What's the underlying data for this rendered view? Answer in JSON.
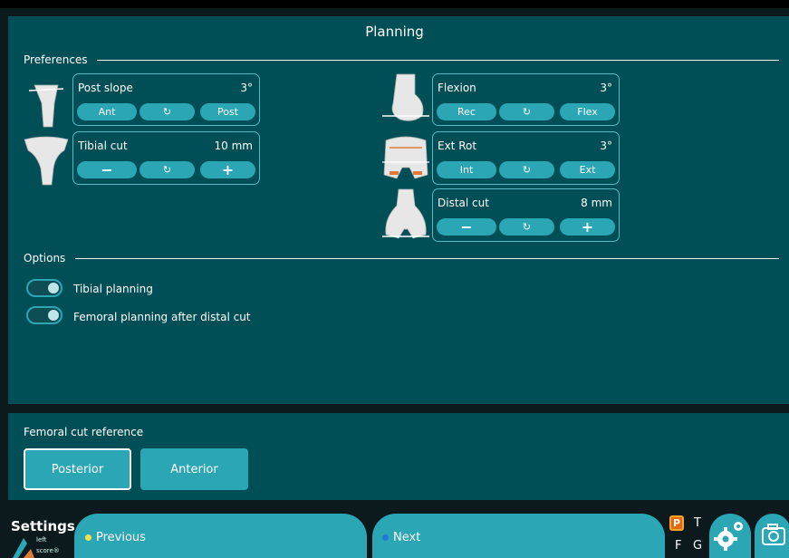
{
  "header": {
    "title": "Planning"
  },
  "preferences": {
    "label": "Preferences",
    "post_slope": {
      "name": "Post slope",
      "value": "3°",
      "btn_left": "Ant",
      "btn_reset": "↻",
      "btn_right": "Post"
    },
    "tibial_cut": {
      "name": "Tibial cut",
      "value": "10 mm",
      "btn_left": "−",
      "btn_reset": "↻",
      "btn_right": "+"
    },
    "flexion": {
      "name": "Flexion",
      "value": "3°",
      "btn_left": "Rec",
      "btn_reset": "↻",
      "btn_right": "Flex"
    },
    "ext_rot": {
      "name": "Ext Rot",
      "value": "3°",
      "btn_left": "Int",
      "btn_reset": "↻",
      "btn_right": "Ext"
    },
    "distal_cut": {
      "name": "Distal cut",
      "value": "8 mm",
      "btn_left": "−",
      "btn_reset": "↻",
      "btn_right": "+"
    }
  },
  "options": {
    "label": "Options",
    "tibial_planning": {
      "label": "Tibial planning",
      "enabled": true
    },
    "femoral_planning": {
      "label": "Femoral planning after distal cut",
      "enabled": true
    }
  },
  "femoral_cut_reference": {
    "label": "Femoral cut reference",
    "options": [
      "Posterior",
      "Anterior"
    ],
    "selected": "Posterior"
  },
  "footer": {
    "title": "Settings",
    "logo_line1": "left",
    "logo_line2": "score®",
    "previous_label": "Previous",
    "next_label": "Next",
    "indicators": {
      "p": "P",
      "t": "T",
      "f": "F",
      "g": "G"
    }
  },
  "icons": [
    "tibia-slope-icon",
    "tibia-cut-icon",
    "femur-flexion-icon",
    "femur-rotation-icon",
    "femur-distal-icon",
    "gear-icon",
    "camera-icon",
    "reset-icon"
  ],
  "colors": {
    "panel": "#004f56",
    "button": "#2aa6b5",
    "background": "#0c1a1e",
    "previous_dot": "#f5e24a",
    "next_dot": "#1e7bd8",
    "active_indicator": "#f5a623"
  }
}
